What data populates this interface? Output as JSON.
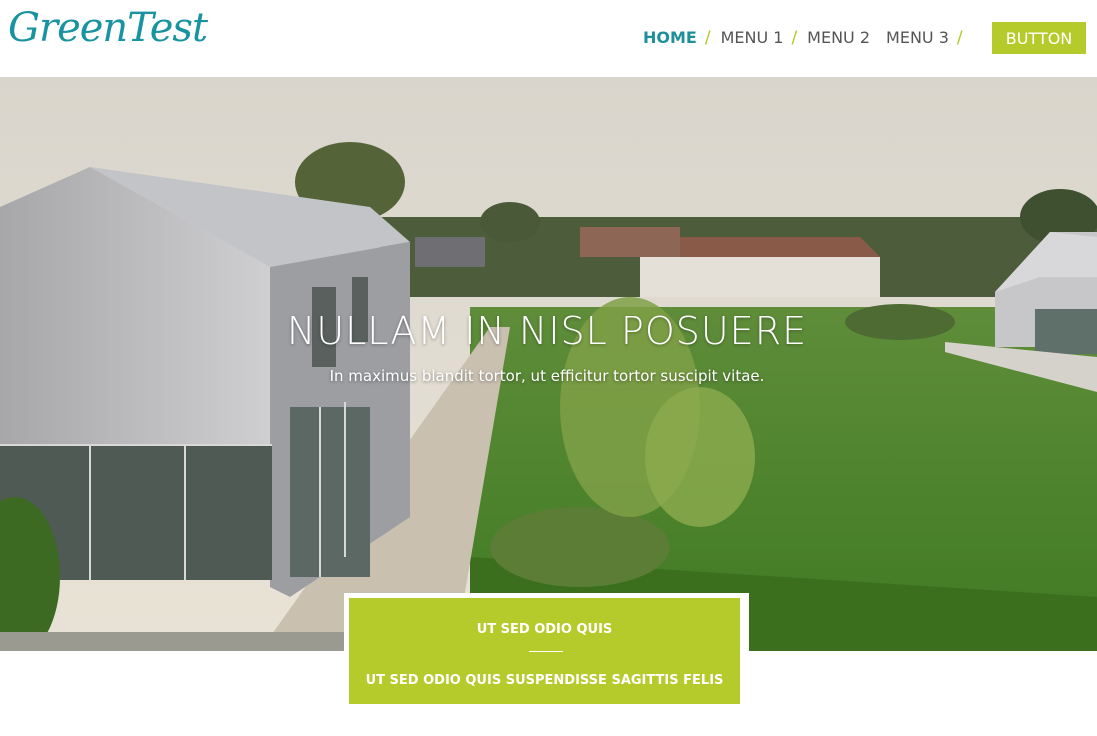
{
  "brand": {
    "logo_text": "GreenTest"
  },
  "nav": {
    "items": [
      {
        "label": "HOME"
      },
      {
        "label": "MENU 1"
      },
      {
        "label": "MENU 2"
      },
      {
        "label": "MENU 3"
      }
    ],
    "separator": "/"
  },
  "header": {
    "button_label": "BUTTON"
  },
  "hero": {
    "title": "NULLAM IN NISL POSUERE",
    "subtitle": "In maximus blandit tortor, ut efficitur tortor suscipit vitae."
  },
  "cta": {
    "line1": "UT SED ODIO QUIS",
    "line2": "UT SED ODIO QUIS SUSPENDISSE SAGITTIS FELIS"
  },
  "colors": {
    "accent": "#b5cb2c",
    "brand": "#1a93a0"
  }
}
